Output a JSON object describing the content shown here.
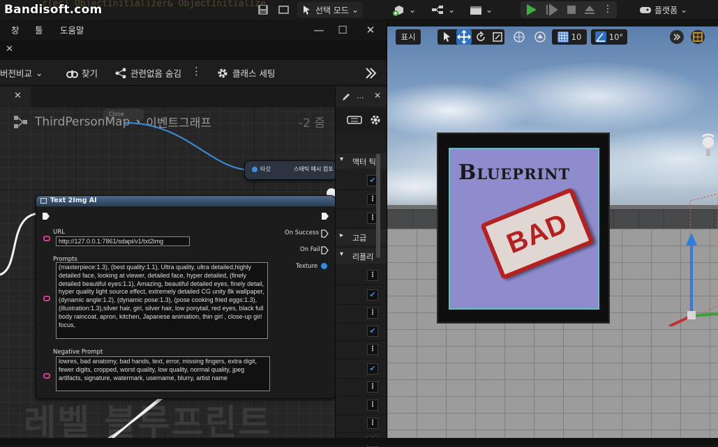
{
  "watermark": "Bandisoft.com",
  "background_code": "r(ec)   ObjectInitializer& ObjectInitialize",
  "top_toolbar": {
    "mode_label": "선택 모드",
    "platform_label": "플랫폼"
  },
  "blueprint_window": {
    "menus": [
      "창",
      "툴",
      "도움말"
    ],
    "toolbar": {
      "diff_label": "버전비교",
      "find_label": "찾기",
      "hide_unrelated_label": "관련없음 숨김",
      "class_settings_label": "클래스 세팅"
    },
    "breadcrumb": {
      "map": "ThirdPersonMap",
      "graph": "이벤트그래프"
    },
    "zoom": "-2 줌",
    "graph_watermark": "레벨 블루프린트",
    "target_node": {
      "target_label": "타깃",
      "component_label": "스태틱 메시 컴포"
    },
    "ghost_node_label": "Close",
    "node": {
      "title": "Text 2Img AI",
      "url_label": "URL",
      "url_value": "http://127.0.0.1:7861/sdapi/v1/txt2img",
      "prompts_label": "Prompts",
      "prompts_value": "(masterpiece:1.3), (best quality:1.1), Ultra quality, ultra detailed,highly detailed face, looking at viewer, detailed face, hyper detailed, (finely detailed beautiful eyes:1.1), Amazing, beautiful detailed eyes, finely detail, hyper quality light source effect, extremely detailed CG unity 8k wallpaper,(dynamic angle:1.2), (dynamic pose:1.3), (pose cooking fried eggs:1.3), (illustration:1.3),silver hair, girl, silver hair, low ponytail, red eyes, black full body raincoat, apron,  kitchen, Japanese animation, thin girl , close-up girl focus,",
      "negative_label": "Negative Prompt",
      "negative_value": "lowres, bad anatomy, bad hands, text, error, missing fingers, extra digit, fewer digits, cropped, worst quality, low quality, normal quality, jpeg artifacts, signature, watermark, username, blurry, artist name",
      "on_success_label": "On Success",
      "on_fail_label": "On Fail",
      "texture_label": "Texture"
    }
  },
  "details_panel": {
    "sections": [
      "액터 틱",
      "고급",
      "리플리"
    ],
    "header_dots": "..."
  },
  "viewport": {
    "show_label": "표시",
    "grid_value": "10",
    "angle_value": "10°",
    "billboard_title": "Blueprint",
    "stamp_text": "BAD"
  }
}
